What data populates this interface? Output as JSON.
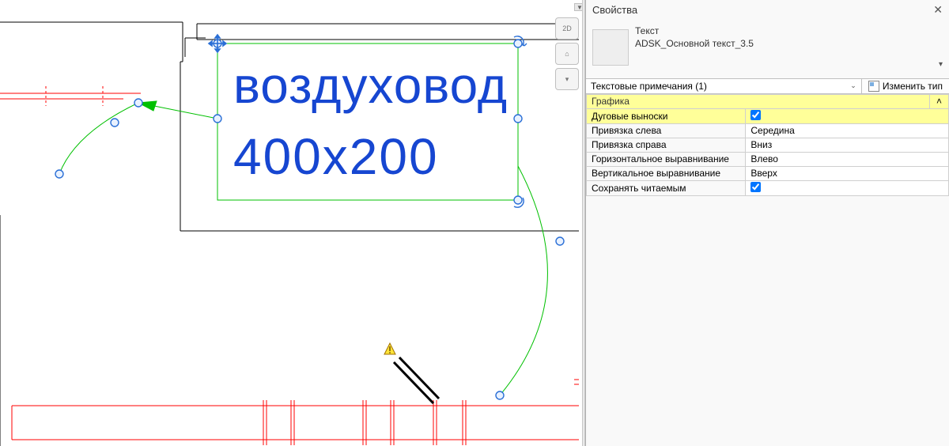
{
  "panel": {
    "title": "Свойства",
    "type_category": "Текст",
    "type_name": "ADSK_Основной текст_3.5",
    "filter": "Текстовые примечания (1)",
    "edit_type": "Изменить тип"
  },
  "props": {
    "group1": "Графика",
    "r1_label": "Дуговые выноски",
    "r1_checked": true,
    "r2_label": "Привязка слева",
    "r2_value": "Середина",
    "r3_label": "Привязка справа",
    "r3_value": "Вниз",
    "r4_label": "Горизонтальное выравнивание",
    "r4_value": "Влево",
    "r5_label": "Вертикальное выравнивание",
    "r5_value": "Вверх",
    "r6_label": "Сохранять читаемым",
    "r6_checked": true
  },
  "drawing": {
    "text_line1": "воздуховод",
    "text_line2": "400х200",
    "viewcube_label": "2D"
  }
}
